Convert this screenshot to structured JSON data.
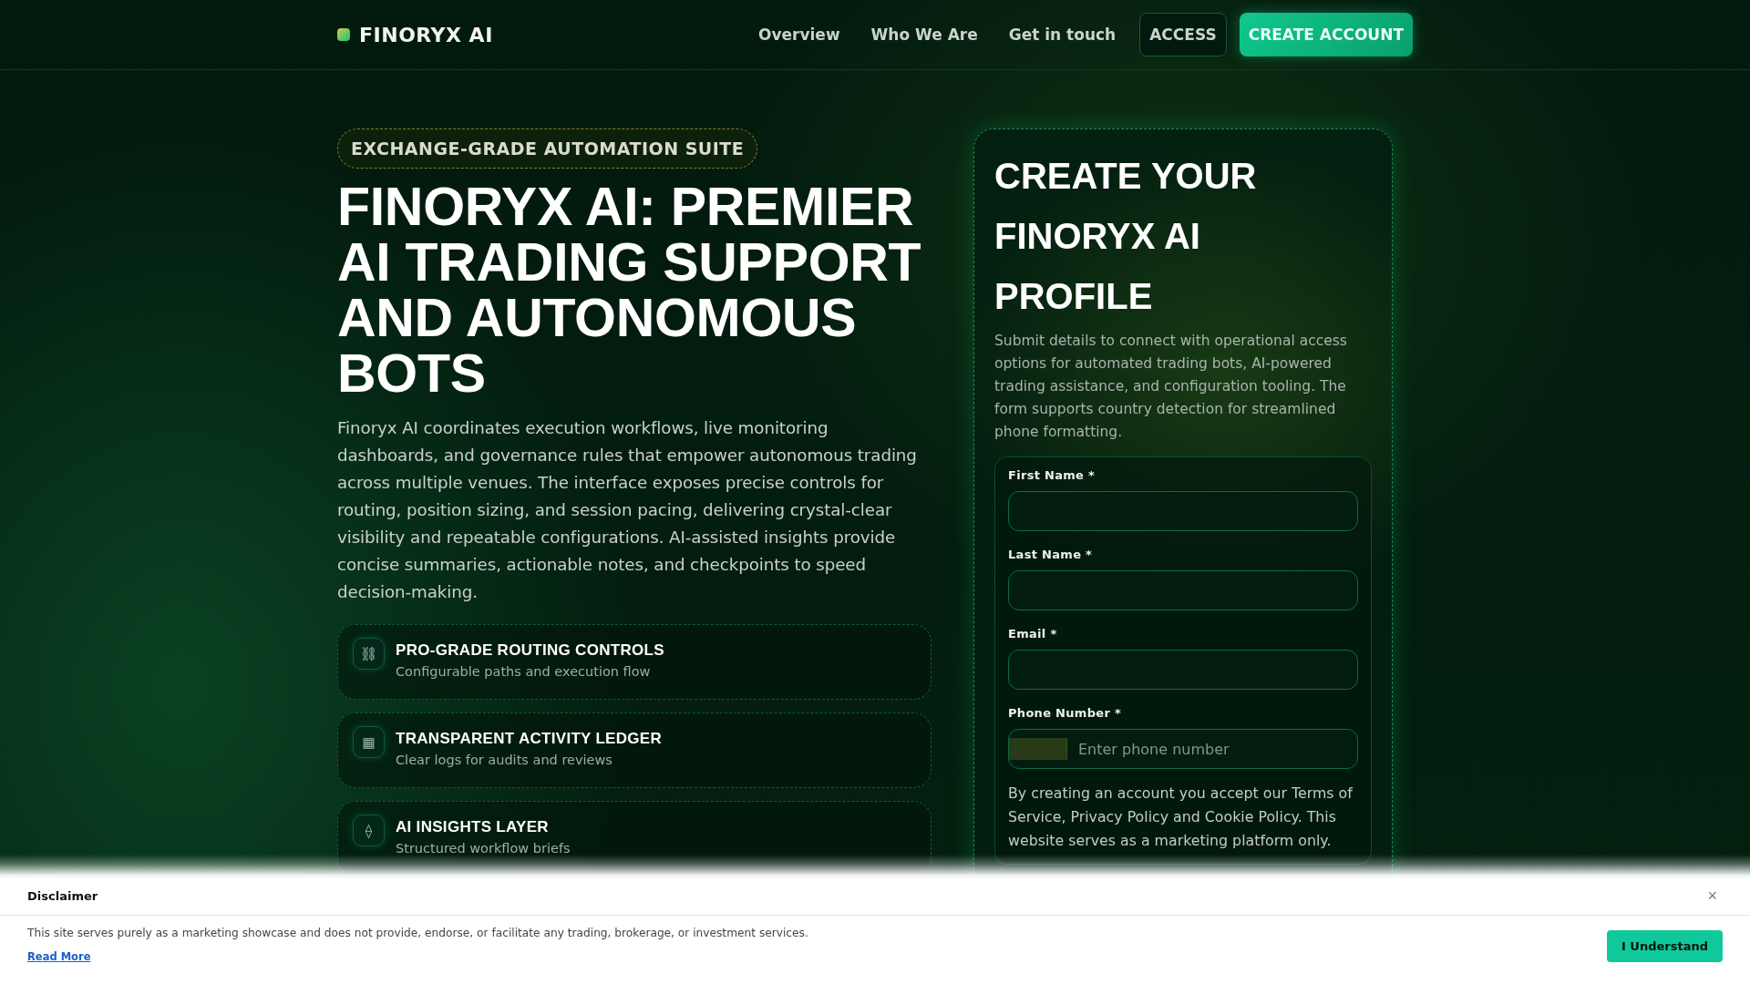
{
  "header": {
    "brand": "FINORYX AI",
    "nav": [
      "Overview",
      "Who We Are",
      "Get in touch"
    ],
    "access_button": "ACCESS",
    "create_button": "CREATE ACCOUNT"
  },
  "hero": {
    "badge": "EXCHANGE-GRADE AUTOMATION SUITE",
    "title": "FINORYX AI: PREMIER AI TRADING SUPPORT AND AUTONOMOUS BOTS",
    "description": "Finoryx AI coordinates execution workflows, live monitoring dashboards, and governance rules that empower autonomous trading across multiple venues. The interface exposes precise controls for routing, position sizing, and session pacing, delivering crystal-clear visibility and repeatable configurations. AI-assisted insights provide concise summaries, actionable notes, and checkpoints to speed decision-making.",
    "features": [
      {
        "icon": "⛓",
        "title": "PRO-GRADE ROUTING CONTROLS",
        "subtitle": "Configurable paths and execution flow"
      },
      {
        "icon": "▦",
        "title": "TRANSPARENT ACTIVITY LEDGER",
        "subtitle": "Clear logs for audits and reviews"
      },
      {
        "icon": "⟠",
        "title": "AI INSIGHTS LAYER",
        "subtitle": "Structured workflow briefs"
      }
    ]
  },
  "signup": {
    "title": "CREATE YOUR FINORYX AI PROFILE",
    "description": "Submit details to connect with operational access options for automated trading bots, AI-powered trading assistance, and configuration tooling. The form supports country detection for streamlined phone formatting.",
    "fields": [
      {
        "kind": "text",
        "label": "First Name *"
      },
      {
        "kind": "text",
        "label": "Last Name *"
      },
      {
        "kind": "text",
        "label": "Email *"
      },
      {
        "kind": "phone",
        "label": "Phone Number *",
        "placeholder": "Enter phone number"
      }
    ],
    "terms": "By creating an account you accept our Terms of Service, Privacy Policy and Cookie Policy. This website serves as a marketing platform only."
  },
  "disclaimer": {
    "title": "Disclaimer",
    "close": "×",
    "text": "This site serves purely as a marketing showcase and does not provide, endorse, or facilitate any trading, brokerage, or investment services.",
    "link": "Read More",
    "button": "I Understand"
  }
}
